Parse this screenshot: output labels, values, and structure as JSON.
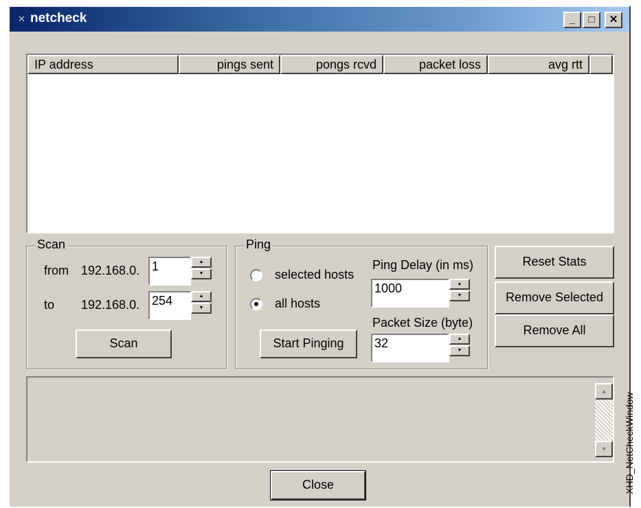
{
  "window": {
    "title": "netcheck",
    "minimize_glyph": "_",
    "maximize_glyph": "□",
    "close_glyph": "✕"
  },
  "list": {
    "columns": [
      "IP address",
      "pings sent",
      "pongs rcvd",
      "packet loss",
      "avg rtt"
    ],
    "rows": []
  },
  "scan": {
    "group_label": "Scan",
    "from_label": "from",
    "to_label": "to",
    "prefix": "192.168.0.",
    "from_value": "1",
    "to_value": "254",
    "button_label": "Scan"
  },
  "ping": {
    "group_label": "Ping",
    "radio_selected_label": "selected hosts",
    "radio_all_label": "all hosts",
    "radio_checked": "all",
    "delay_label": "Ping Delay (in ms)",
    "delay_value": "1000",
    "size_label": "Packet Size (byte)",
    "size_value": "32",
    "start_button_label": "Start Pinging"
  },
  "actions": {
    "reset_label": "Reset Stats",
    "remove_selected_label": "Remove Selected",
    "remove_all_label": "Remove All"
  },
  "footer": {
    "close_label": "Close"
  },
  "caption": "XHD_NetCheckWindow",
  "icons": {
    "app": "app-icon",
    "spin_up": "up-arrow-icon",
    "spin_down": "down-arrow-icon"
  },
  "colors": {
    "face": "#d4d0c8",
    "title_start": "#0a246a",
    "title_end": "#a6caf0"
  }
}
